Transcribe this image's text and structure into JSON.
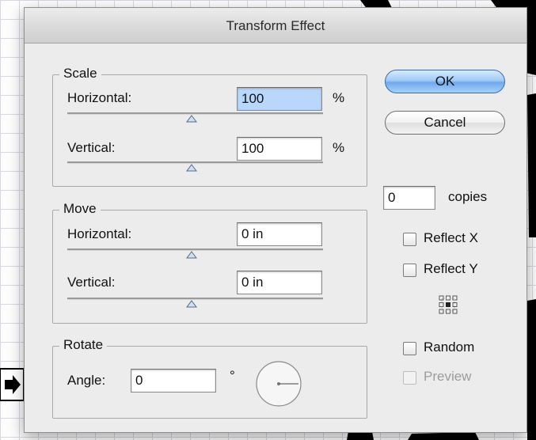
{
  "dialog": {
    "title": "Transform Effect"
  },
  "scale": {
    "title": "Scale",
    "horizontal": {
      "label": "Horizontal:",
      "value": "100",
      "unit": "%"
    },
    "vertical": {
      "label": "Vertical:",
      "value": "100",
      "unit": "%"
    }
  },
  "move": {
    "title": "Move",
    "horizontal": {
      "label": "Horizontal:",
      "value": "0 in"
    },
    "vertical": {
      "label": "Vertical:",
      "value": "0 in"
    }
  },
  "rotate": {
    "title": "Rotate",
    "angle_label": "Angle:",
    "angle_value": "0",
    "degree_symbol": "°"
  },
  "buttons": {
    "ok": "OK",
    "cancel": "Cancel"
  },
  "copies": {
    "value": "0",
    "label": "copies"
  },
  "options": {
    "reflect_x": {
      "label": "Reflect X",
      "checked": false
    },
    "reflect_y": {
      "label": "Reflect Y",
      "checked": false
    },
    "random": {
      "label": "Random",
      "checked": false
    },
    "preview": {
      "label": "Preview",
      "checked": false,
      "enabled": false
    }
  },
  "colors": {
    "dialog_bg": "#ececec",
    "selected_field": "#b8d7fb",
    "default_button": "#6fa9ec"
  },
  "icons": {
    "reference_point": "reference-point-locator-icon",
    "rotate_dial": "angle-dial-icon",
    "slider_thumb": "triangle-slider-thumb-icon"
  }
}
